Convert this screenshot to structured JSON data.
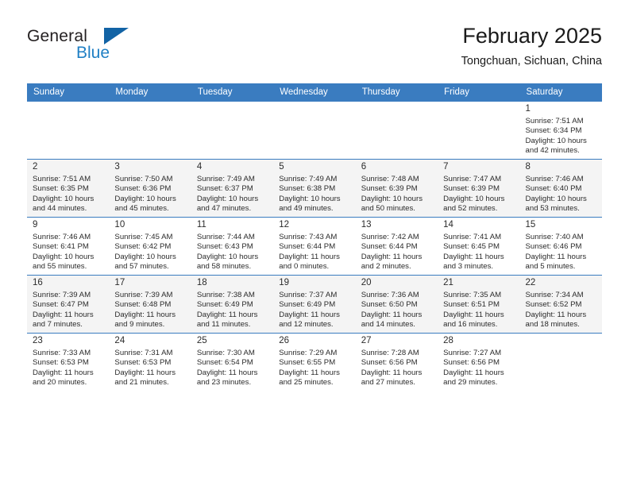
{
  "brand": {
    "name_top": "General",
    "name_bottom": "Blue",
    "triangle_color": "#1263a5",
    "blue_color": "#1f7fc4"
  },
  "header": {
    "month_title": "February 2025",
    "location": "Tongchuan, Sichuan, China"
  },
  "theme": {
    "header_row_bg": "#3a7cc0",
    "header_row_text": "#ffffff",
    "shaded_row_bg": "#f4f4f4",
    "cell_border": "#3a7cc0"
  },
  "calendar": {
    "weekday_headers": [
      "Sunday",
      "Monday",
      "Tuesday",
      "Wednesday",
      "Thursday",
      "Friday",
      "Saturday"
    ],
    "weeks": [
      {
        "shaded": false,
        "days": [
          {
            "day": "",
            "detail": ""
          },
          {
            "day": "",
            "detail": ""
          },
          {
            "day": "",
            "detail": ""
          },
          {
            "day": "",
            "detail": ""
          },
          {
            "day": "",
            "detail": ""
          },
          {
            "day": "",
            "detail": ""
          },
          {
            "day": "1",
            "detail": "Sunrise: 7:51 AM\nSunset: 6:34 PM\nDaylight: 10 hours\nand 42 minutes."
          }
        ]
      },
      {
        "shaded": true,
        "days": [
          {
            "day": "2",
            "detail": "Sunrise: 7:51 AM\nSunset: 6:35 PM\nDaylight: 10 hours\nand 44 minutes."
          },
          {
            "day": "3",
            "detail": "Sunrise: 7:50 AM\nSunset: 6:36 PM\nDaylight: 10 hours\nand 45 minutes."
          },
          {
            "day": "4",
            "detail": "Sunrise: 7:49 AM\nSunset: 6:37 PM\nDaylight: 10 hours\nand 47 minutes."
          },
          {
            "day": "5",
            "detail": "Sunrise: 7:49 AM\nSunset: 6:38 PM\nDaylight: 10 hours\nand 49 minutes."
          },
          {
            "day": "6",
            "detail": "Sunrise: 7:48 AM\nSunset: 6:39 PM\nDaylight: 10 hours\nand 50 minutes."
          },
          {
            "day": "7",
            "detail": "Sunrise: 7:47 AM\nSunset: 6:39 PM\nDaylight: 10 hours\nand 52 minutes."
          },
          {
            "day": "8",
            "detail": "Sunrise: 7:46 AM\nSunset: 6:40 PM\nDaylight: 10 hours\nand 53 minutes."
          }
        ]
      },
      {
        "shaded": false,
        "days": [
          {
            "day": "9",
            "detail": "Sunrise: 7:46 AM\nSunset: 6:41 PM\nDaylight: 10 hours\nand 55 minutes."
          },
          {
            "day": "10",
            "detail": "Sunrise: 7:45 AM\nSunset: 6:42 PM\nDaylight: 10 hours\nand 57 minutes."
          },
          {
            "day": "11",
            "detail": "Sunrise: 7:44 AM\nSunset: 6:43 PM\nDaylight: 10 hours\nand 58 minutes."
          },
          {
            "day": "12",
            "detail": "Sunrise: 7:43 AM\nSunset: 6:44 PM\nDaylight: 11 hours\nand 0 minutes."
          },
          {
            "day": "13",
            "detail": "Sunrise: 7:42 AM\nSunset: 6:44 PM\nDaylight: 11 hours\nand 2 minutes."
          },
          {
            "day": "14",
            "detail": "Sunrise: 7:41 AM\nSunset: 6:45 PM\nDaylight: 11 hours\nand 3 minutes."
          },
          {
            "day": "15",
            "detail": "Sunrise: 7:40 AM\nSunset: 6:46 PM\nDaylight: 11 hours\nand 5 minutes."
          }
        ]
      },
      {
        "shaded": true,
        "days": [
          {
            "day": "16",
            "detail": "Sunrise: 7:39 AM\nSunset: 6:47 PM\nDaylight: 11 hours\nand 7 minutes."
          },
          {
            "day": "17",
            "detail": "Sunrise: 7:39 AM\nSunset: 6:48 PM\nDaylight: 11 hours\nand 9 minutes."
          },
          {
            "day": "18",
            "detail": "Sunrise: 7:38 AM\nSunset: 6:49 PM\nDaylight: 11 hours\nand 11 minutes."
          },
          {
            "day": "19",
            "detail": "Sunrise: 7:37 AM\nSunset: 6:49 PM\nDaylight: 11 hours\nand 12 minutes."
          },
          {
            "day": "20",
            "detail": "Sunrise: 7:36 AM\nSunset: 6:50 PM\nDaylight: 11 hours\nand 14 minutes."
          },
          {
            "day": "21",
            "detail": "Sunrise: 7:35 AM\nSunset: 6:51 PM\nDaylight: 11 hours\nand 16 minutes."
          },
          {
            "day": "22",
            "detail": "Sunrise: 7:34 AM\nSunset: 6:52 PM\nDaylight: 11 hours\nand 18 minutes."
          }
        ]
      },
      {
        "shaded": false,
        "days": [
          {
            "day": "23",
            "detail": "Sunrise: 7:33 AM\nSunset: 6:53 PM\nDaylight: 11 hours\nand 20 minutes."
          },
          {
            "day": "24",
            "detail": "Sunrise: 7:31 AM\nSunset: 6:53 PM\nDaylight: 11 hours\nand 21 minutes."
          },
          {
            "day": "25",
            "detail": "Sunrise: 7:30 AM\nSunset: 6:54 PM\nDaylight: 11 hours\nand 23 minutes."
          },
          {
            "day": "26",
            "detail": "Sunrise: 7:29 AM\nSunset: 6:55 PM\nDaylight: 11 hours\nand 25 minutes."
          },
          {
            "day": "27",
            "detail": "Sunrise: 7:28 AM\nSunset: 6:56 PM\nDaylight: 11 hours\nand 27 minutes."
          },
          {
            "day": "28",
            "detail": "Sunrise: 7:27 AM\nSunset: 6:56 PM\nDaylight: 11 hours\nand 29 minutes."
          },
          {
            "day": "",
            "detail": ""
          }
        ]
      }
    ]
  }
}
